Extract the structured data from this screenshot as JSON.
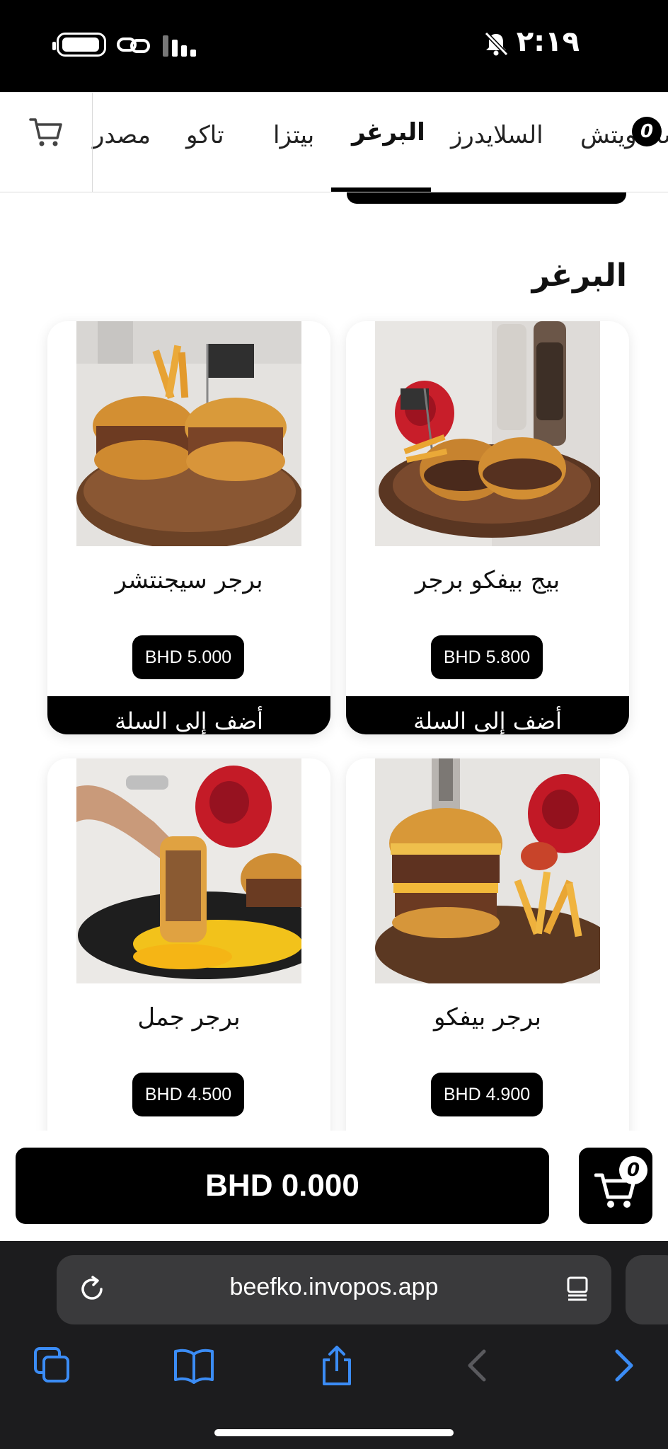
{
  "status_bar": {
    "time": "٢:١٩"
  },
  "category_nav": {
    "items": [
      "الساندويتش",
      "السلايدرز",
      "البرغر",
      "بيتزا",
      "تاكو",
      "مصدر"
    ],
    "active_index": 2,
    "badge_count": "0"
  },
  "section": {
    "title": "البرغر"
  },
  "products": [
    {
      "name": "بيج بيفكو برجر",
      "price": "BHD 5.800",
      "add_label": "أضف إلى السلة"
    },
    {
      "name": "برجر سيجنتشر",
      "price": "BHD 5.000",
      "add_label": "أضف إلى السلة"
    },
    {
      "name": "برجر بيفكو",
      "price": "BHD 4.900",
      "add_label": ""
    },
    {
      "name": "برجر جمل",
      "price": "BHD 4.500",
      "add_label": ""
    }
  ],
  "cart_bar": {
    "total": "BHD 0.000",
    "count": "0"
  },
  "browser": {
    "url": "beefko.invopos.app"
  },
  "colors": {
    "primary": "#000000",
    "background": "#ffffff",
    "browser_bg": "#1c1c1e",
    "browser_accent": "#3b8cf5"
  }
}
